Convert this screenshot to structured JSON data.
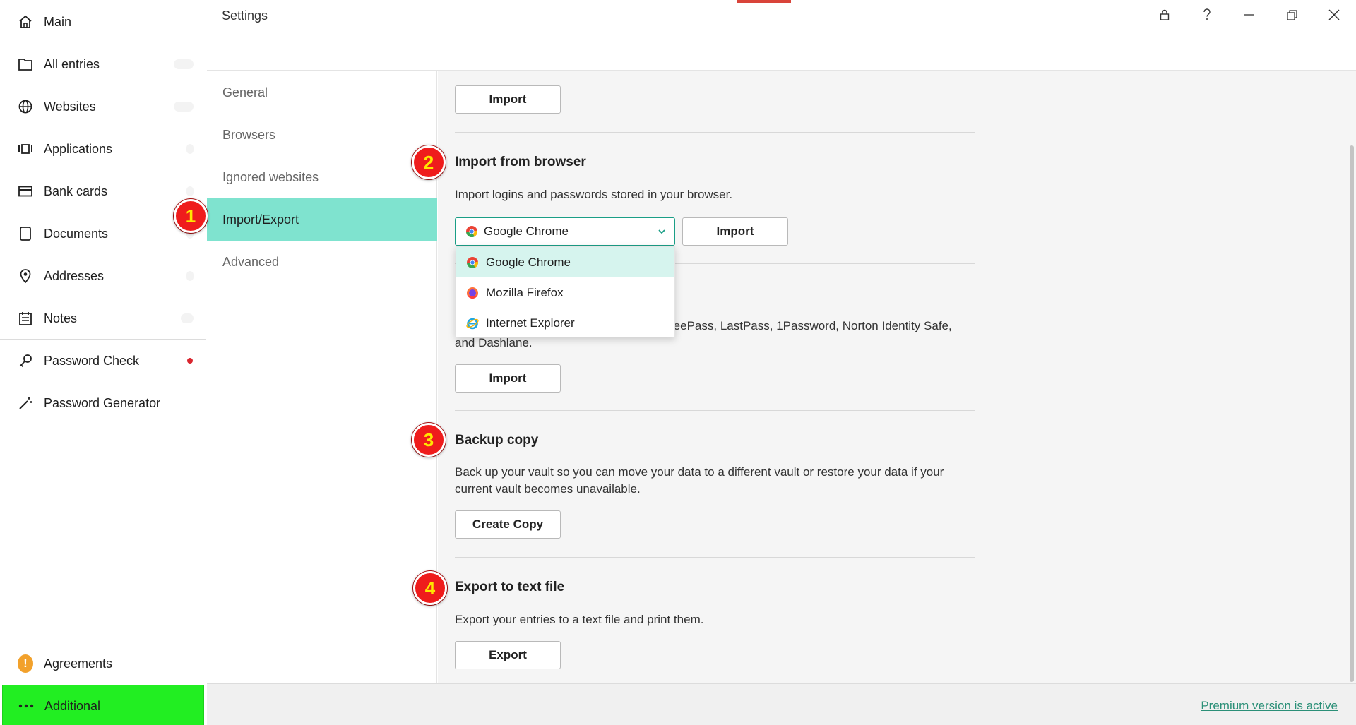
{
  "window": {
    "title": "Settings"
  },
  "sidebar": {
    "items": [
      {
        "label": "Main",
        "icon": "home-icon"
      },
      {
        "label": "All entries",
        "icon": "folder-icon"
      },
      {
        "label": "Websites",
        "icon": "globe-icon"
      },
      {
        "label": "Applications",
        "icon": "applications-icon"
      },
      {
        "label": "Bank cards",
        "icon": "card-icon"
      },
      {
        "label": "Documents",
        "icon": "document-icon"
      },
      {
        "label": "Addresses",
        "icon": "location-pin-icon"
      },
      {
        "label": "Notes",
        "icon": "notes-icon"
      },
      {
        "label": "Password Check",
        "icon": "key-icon"
      },
      {
        "label": "Password Generator",
        "icon": "magic-wand-icon"
      }
    ],
    "agreements": {
      "label": "Agreements",
      "icon": "warning-icon",
      "glyph": "!"
    },
    "additional": {
      "label": "Additional",
      "icon": "more-dots-icon"
    }
  },
  "settings_nav": {
    "items": [
      {
        "label": "General"
      },
      {
        "label": "Browsers"
      },
      {
        "label": "Ignored websites"
      },
      {
        "label": "Import/Export",
        "active": true
      },
      {
        "label": "Advanced"
      }
    ]
  },
  "content": {
    "top_import_button": "Import",
    "browser_section": {
      "heading": "Import from browser",
      "description": "Import logins and passwords stored in your browser.",
      "selected_browser": "Google Chrome",
      "import_button": "Import",
      "options": [
        "Google Chrome",
        "Mozilla Firefox",
        "Internet Explorer"
      ]
    },
    "other_section": {
      "description_line1": "om KeePass, LastPass, 1Password, Norton Identity Safe,",
      "description_line2": "and Dashlane.",
      "import_button": "Import"
    },
    "backup_section": {
      "heading": "Backup copy",
      "description_line1": "Back up your vault so you can move your data to a different vault or restore your data if your",
      "description_line2": "current vault becomes unavailable.",
      "button": "Create Copy"
    },
    "export_section": {
      "heading": "Export to text file",
      "description": "Export your entries to a text file and print them.",
      "button": "Export"
    }
  },
  "steps": [
    "1",
    "2",
    "3",
    "4"
  ],
  "status": {
    "premium": "Premium version is active"
  },
  "colors": {
    "active_section": "#7fe3cf",
    "additional_bg": "#22ee22",
    "accent": "#1a9e86",
    "step_badge": "#ef1c1c",
    "step_text": "#ffe600"
  }
}
